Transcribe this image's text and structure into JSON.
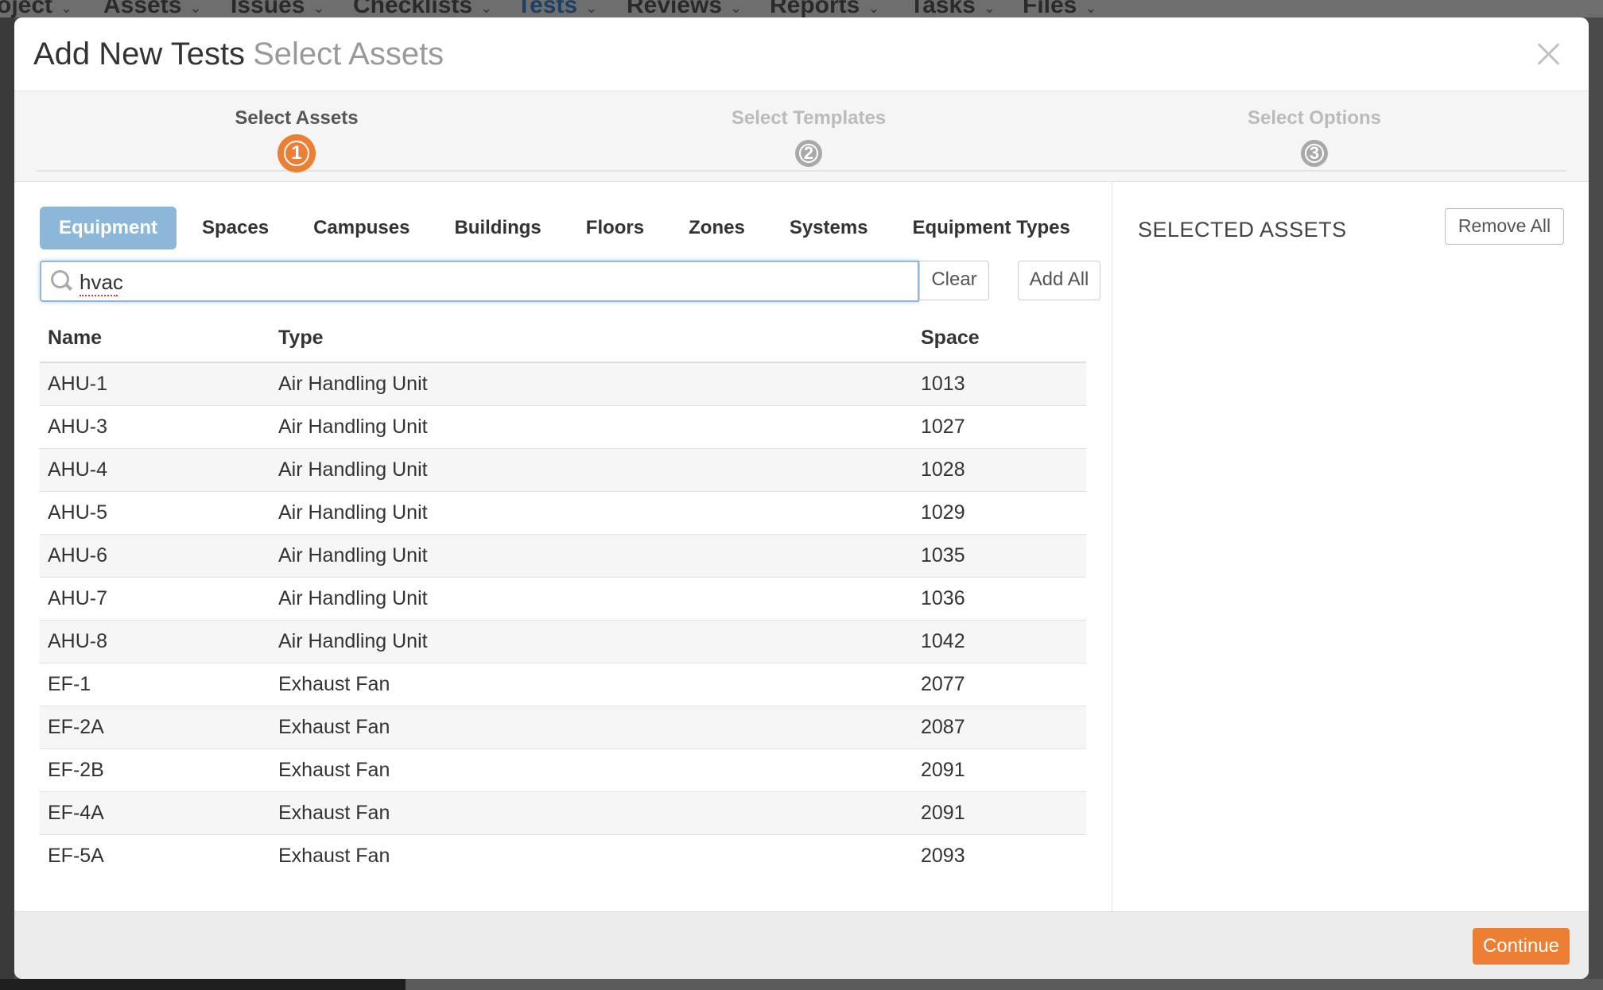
{
  "background_nav": {
    "items": [
      "oject",
      "Assets",
      "Issues",
      "Checklists",
      "Tests",
      "Reviews",
      "Reports",
      "Tasks",
      "Files"
    ],
    "active": "Tests"
  },
  "modal": {
    "title": "Add New Tests",
    "subtitle": "Select Assets",
    "close_icon": "close-icon"
  },
  "wizard": {
    "steps": [
      {
        "label": "Select Assets",
        "number": "1",
        "active": true
      },
      {
        "label": "Select Templates",
        "number": "2",
        "active": false
      },
      {
        "label": "Select Options",
        "number": "3",
        "active": false
      }
    ]
  },
  "tabs": [
    {
      "label": "Equipment",
      "active": true
    },
    {
      "label": "Spaces"
    },
    {
      "label": "Campuses"
    },
    {
      "label": "Buildings"
    },
    {
      "label": "Floors"
    },
    {
      "label": "Zones"
    },
    {
      "label": "Systems"
    },
    {
      "label": "Equipment Types"
    }
  ],
  "search": {
    "value": "hvac",
    "icon": "search-icon",
    "clear_label": "Clear",
    "add_all_label": "Add All"
  },
  "table": {
    "headers": {
      "name": "Name",
      "type": "Type",
      "space": "Space"
    },
    "rows": [
      {
        "name": "AHU-1",
        "type": "Air Handling Unit",
        "space": "1013"
      },
      {
        "name": "AHU-3",
        "type": "Air Handling Unit",
        "space": "1027"
      },
      {
        "name": "AHU-4",
        "type": "Air Handling Unit",
        "space": "1028"
      },
      {
        "name": "AHU-5",
        "type": "Air Handling Unit",
        "space": "1029"
      },
      {
        "name": "AHU-6",
        "type": "Air Handling Unit",
        "space": "1035"
      },
      {
        "name": "AHU-7",
        "type": "Air Handling Unit",
        "space": "1036"
      },
      {
        "name": "AHU-8",
        "type": "Air Handling Unit",
        "space": "1042"
      },
      {
        "name": "EF-1",
        "type": "Exhaust Fan",
        "space": "2077"
      },
      {
        "name": "EF-2A",
        "type": "Exhaust Fan",
        "space": "2087"
      },
      {
        "name": "EF-2B",
        "type": "Exhaust Fan",
        "space": "2091"
      },
      {
        "name": "EF-4A",
        "type": "Exhaust Fan",
        "space": "2091"
      },
      {
        "name": "EF-5A",
        "type": "Exhaust Fan",
        "space": "2093"
      }
    ]
  },
  "selected": {
    "title": "SELECTED ASSETS",
    "remove_all_label": "Remove All"
  },
  "footer": {
    "continue_label": "Continue"
  },
  "colors": {
    "accent_orange": "#ec7f33",
    "tab_active_blue": "#8cb7d8",
    "focus_blue": "#8fb8dc"
  }
}
